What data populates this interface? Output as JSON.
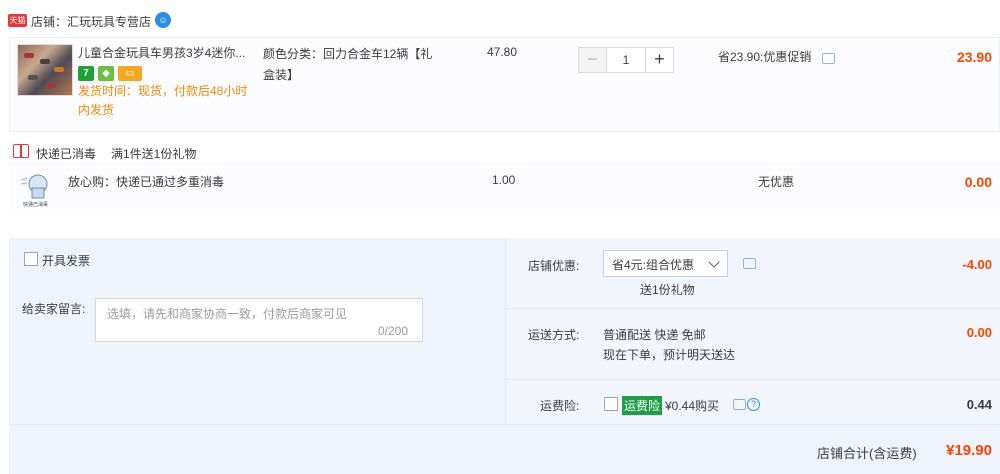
{
  "store": {
    "badge": "天猫",
    "label": "店铺：汇玩玩具专营店"
  },
  "item": {
    "title": "儿童合金玩具车男孩3岁4迷你...",
    "shipping_line1": "发货时间：现货，付款后48小时",
    "shipping_line2": "内发货",
    "sku_line1": "颜色分类：回力合金车12辆【礼",
    "sku_line2": "盒装】",
    "price": "47.80",
    "qty": "1",
    "minus": "−",
    "plus": "+",
    "promo": "省23.90:优惠促销",
    "subtotal": "23.90",
    "icon_7": "7"
  },
  "gift": {
    "label": "快递已消毒",
    "desc": "满1件送1份礼物",
    "title": "放心购：快递已通过多重消毒",
    "price": "1.00",
    "promo": "无优惠",
    "subtotal": "0.00",
    "thumb_caption": "快递已消毒"
  },
  "order": {
    "invoice_label": "开具发票",
    "memo_label": "给卖家留言:",
    "memo_placeholder": "选填，请先和商家协商一致，付款后商家可见",
    "memo_count": "0/200",
    "discount_label": "店铺优惠:",
    "discount_select": "省4元:组合优惠",
    "discount_gift": "送1份礼物",
    "discount_value": "-4.00",
    "delivery_label": "运送方式:",
    "delivery_line1": "普通配送 快递 免邮",
    "delivery_line2": "现在下单，预计明天送达",
    "delivery_value": "0.00",
    "insurance_label": "运费险:",
    "insurance_badge": "运费险",
    "insurance_text": "¥0.44购买",
    "insurance_value": "0.44",
    "total_label": "店铺合计(含运费)",
    "total_value": "¥19.90"
  },
  "colors": {
    "accent": "#ff4400",
    "tmall_red": "#e4393c",
    "ship_orange": "#f48a05",
    "blue": "#2a8de8",
    "green": "#1e9e48"
  }
}
